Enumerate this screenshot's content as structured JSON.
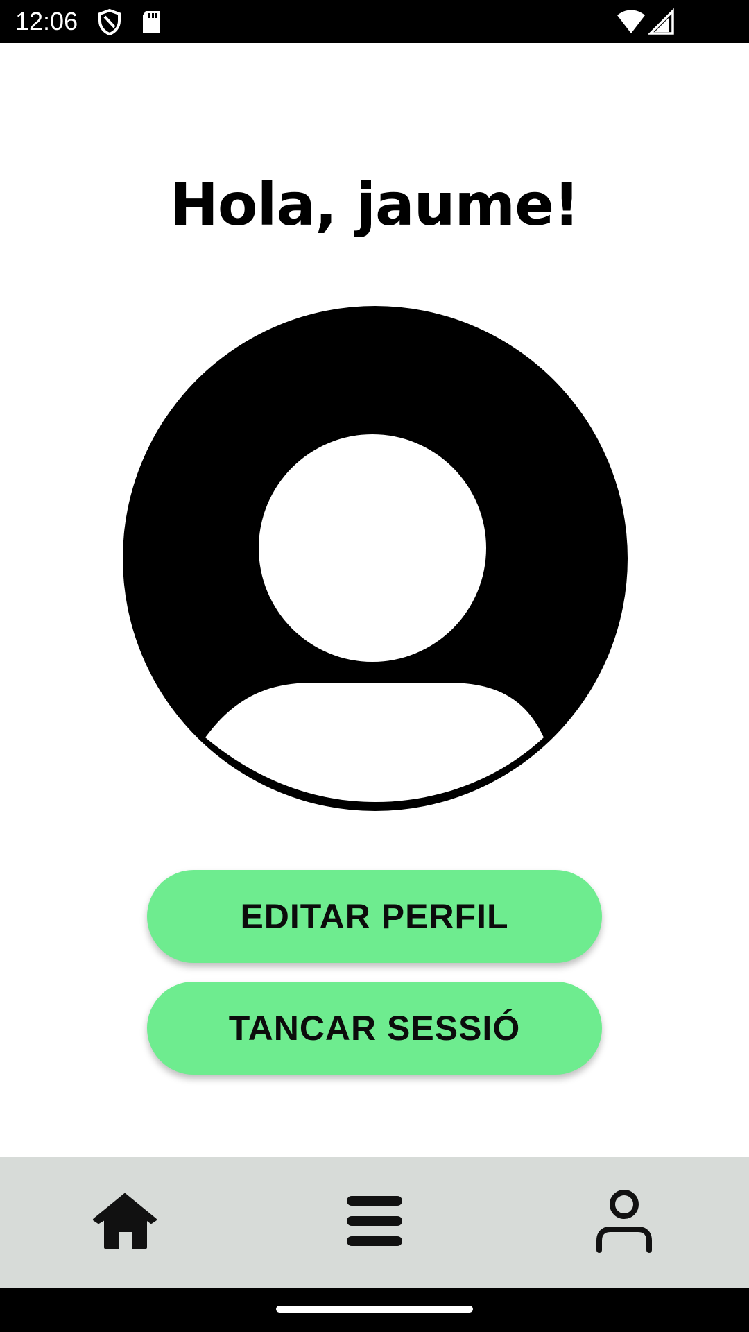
{
  "status_bar": {
    "time": "12:06",
    "icons": [
      "shield-icon",
      "sd-card-icon",
      "wifi-icon",
      "signal-icon"
    ]
  },
  "profile": {
    "greeting": "Hola, jaume!",
    "avatar_icon": "account-circle-icon"
  },
  "actions": {
    "edit_profile_label": "EDITAR PERFIL",
    "logout_label": "TANCAR SESSIÓ"
  },
  "bottom_nav": {
    "items": [
      {
        "icon": "home-icon"
      },
      {
        "icon": "menu-icon"
      },
      {
        "icon": "person-icon"
      }
    ]
  },
  "colors": {
    "accent": "#6eec8f",
    "nav_background": "#d7dbd8",
    "text": "#000000"
  }
}
